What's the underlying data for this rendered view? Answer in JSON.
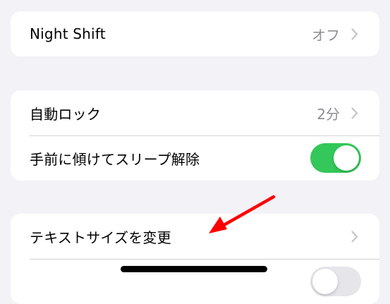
{
  "groups": [
    {
      "rows": [
        {
          "label": "Night Shift",
          "value": "オフ",
          "accessory": "chevron-right-icon"
        }
      ]
    },
    {
      "rows": [
        {
          "label": "自動ロック",
          "value": "2分",
          "accessory": "chevron-right-icon"
        },
        {
          "label": "手前に傾けてスリープ解除",
          "toggle": "on"
        }
      ]
    },
    {
      "rows": [
        {
          "label": "テキストサイズを変更",
          "accessory": "chevron-right-icon"
        },
        {
          "label": "",
          "toggle": "off"
        }
      ]
    }
  ],
  "annotation": {
    "type": "arrow",
    "color": "#ff0000",
    "points_to": "テキストサイズを変更"
  },
  "colors": {
    "background": "#f2f2f7",
    "cell": "#ffffff",
    "toggle_on": "#34c759",
    "secondary_text": "#8e8e93",
    "chevron": "#c4c4c7"
  }
}
